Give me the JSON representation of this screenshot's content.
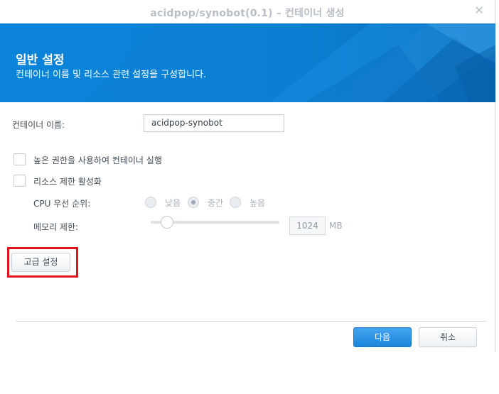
{
  "window": {
    "title": "acidpop/synobot(0.1) – 컨테이너 생성",
    "close_icon": "close-icon"
  },
  "banner": {
    "title": "일반 설정",
    "subtitle": "컨테이너 이름 및 리소스 관련 설정을 구성합니다.",
    "color": "#0a7fd6"
  },
  "form": {
    "container_name_label": "컨테이너 이름:",
    "container_name_value": "acidpop-synobot",
    "privileged_label": "높은 권한을 사용하여 컨테이너 실행",
    "privileged_checked": false,
    "resource_limit_label": "리소스 제한 활성화",
    "resource_limit_checked": false,
    "cpu_priority_label": "CPU 우선 순위:",
    "cpu_options": [
      "낮음",
      "중간",
      "높음"
    ],
    "cpu_selected": "중간",
    "memory_limit_label": "메모리 제한:",
    "memory_value": "1024",
    "memory_unit": "MB"
  },
  "buttons": {
    "advanced": "고급 설정",
    "next": "다음",
    "cancel": "취소"
  },
  "colors": {
    "highlight": "#e0141b",
    "primary": "#1a86dc"
  }
}
